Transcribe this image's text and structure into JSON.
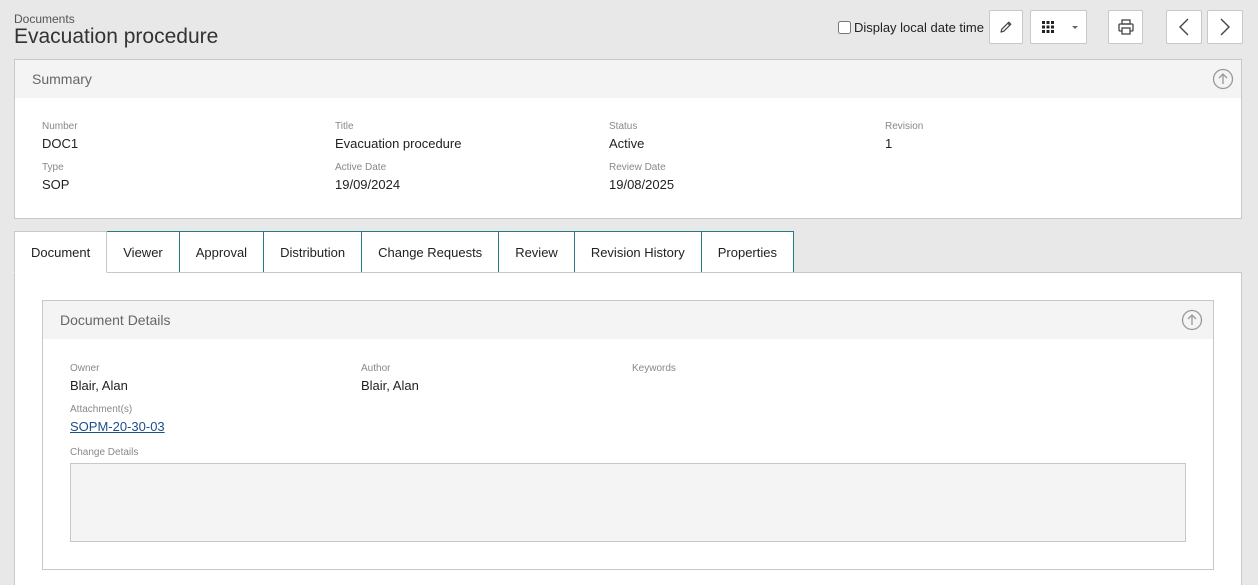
{
  "header": {
    "breadcrumb": "Documents",
    "title": "Evacuation procedure"
  },
  "toolbar": {
    "local_date_label": "Display local date time",
    "local_date_checked": false,
    "icons": [
      "pencil-icon",
      "grid-menu-icon",
      "printer-icon",
      "chevron-left-icon",
      "chevron-right-icon"
    ]
  },
  "summary": {
    "title": "Summary",
    "fields": {
      "number": {
        "label": "Number",
        "value": "DOC1"
      },
      "title": {
        "label": "Title",
        "value": "Evacuation procedure"
      },
      "status": {
        "label": "Status",
        "value": "Active"
      },
      "revision": {
        "label": "Revision",
        "value": "1"
      },
      "type": {
        "label": "Type",
        "value": "SOP"
      },
      "active_date": {
        "label": "Active Date",
        "value": "19/09/2024"
      },
      "review_date": {
        "label": "Review Date",
        "value": "19/08/2025"
      }
    }
  },
  "tabs": [
    "Document",
    "Viewer",
    "Approval",
    "Distribution",
    "Change Requests",
    "Review",
    "Revision History",
    "Properties"
  ],
  "active_tab": "Document",
  "document_details": {
    "title": "Document Details",
    "owner": {
      "label": "Owner",
      "value": "Blair, Alan"
    },
    "author": {
      "label": "Author",
      "value": "Blair, Alan"
    },
    "keywords": {
      "label": "Keywords",
      "value": ""
    },
    "attachments": {
      "label": "Attachment(s)",
      "value": "SOPM-20-30-03"
    },
    "change_details": {
      "label": "Change Details",
      "value": ""
    }
  },
  "colors": {
    "tab_border": "#2a7a86",
    "link": "#1a4f8a",
    "background": "#e8e8e8"
  }
}
